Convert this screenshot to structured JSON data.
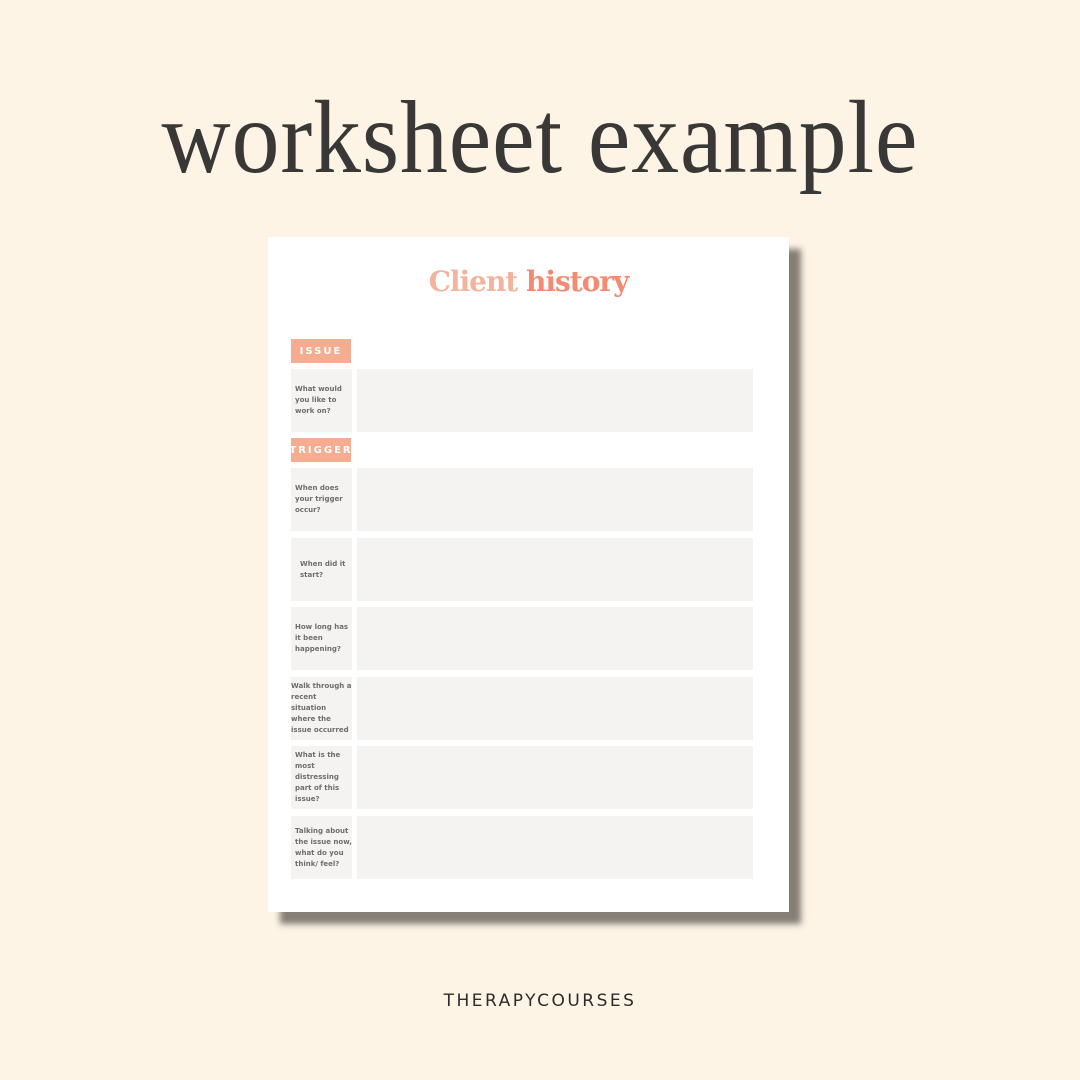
{
  "headline": "worksheet example",
  "worksheet": {
    "title_part1": "Client",
    "title_part2": "history",
    "sections": [
      {
        "label": "ISSUE",
        "questions": [
          "What would you like to work on?"
        ]
      },
      {
        "label": "TRIGGER",
        "questions": [
          "When does your trigger occur?",
          "When did it start?",
          "How long has it been happening?",
          "Walk through a  recent situation where the issue occurred",
          "What is the most distressing part of this issue?",
          "Talking about the issue now, what do you think/ feel?"
        ]
      }
    ]
  },
  "footer": "THERAPYCOURSES",
  "colors": {
    "background": "#fdf4e6",
    "accent": "#f5ac90",
    "title_light": "#f4b39c",
    "title_dark": "#f28b72",
    "cell": "#f4f3f1"
  }
}
